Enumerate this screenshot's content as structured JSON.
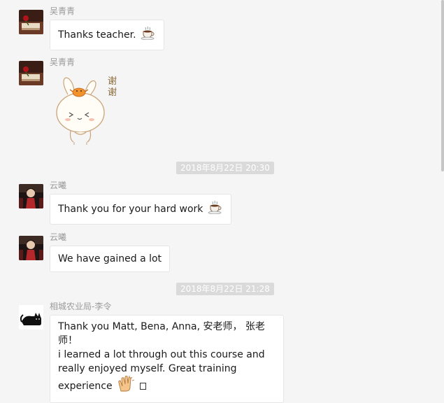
{
  "messages": [
    {
      "sender": "吴青青",
      "text": "Thanks teacher.",
      "emoji": "coffee-icon"
    },
    {
      "sender": "吴青青",
      "sticker": "rabbit-sticker",
      "sticker_text": "谢谢"
    },
    {
      "sender": "云曦",
      "text": "Thank you for your hard work",
      "emoji": "coffee-icon"
    },
    {
      "sender": "云曦",
      "text": "We have gained a lot"
    },
    {
      "sender": "相城农业局-李令",
      "lines": [
        "Thank you Matt, Bena, Anna, 安老师， 张老师！",
        "i learned a lot through out this course and",
        "really enjoyed myself. Great training",
        "experience"
      ],
      "emoji": "clapping-hands-icon"
    }
  ],
  "timestamps": [
    "2018年8月22日 20:30",
    "2018年8月22日 21:28"
  ],
  "colors": {
    "background": "#f5f5f5",
    "bubble": "#ffffff",
    "timestamp_bg": "#dadada",
    "sender_text": "#9a9a9a"
  }
}
